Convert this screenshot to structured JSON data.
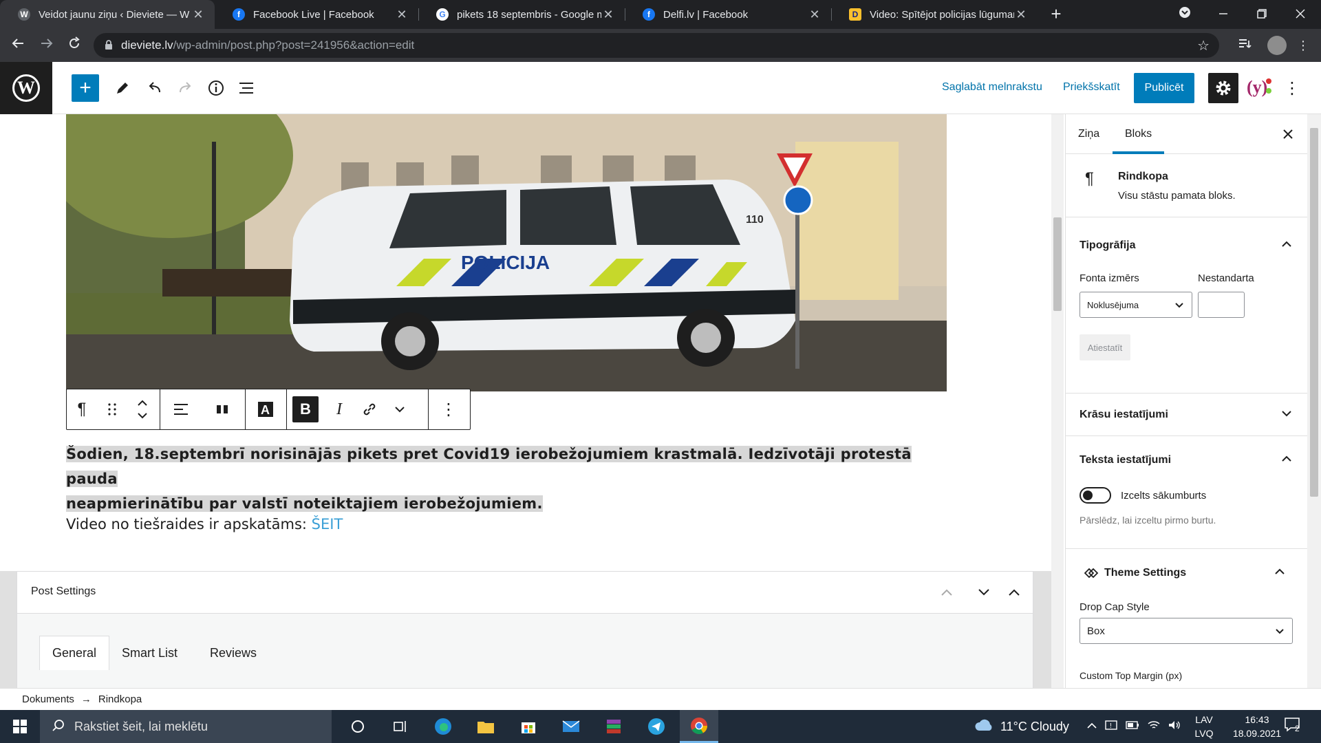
{
  "browser": {
    "tabs": [
      {
        "title": "Veidot jaunu ziņu ‹ Dieviete — W",
        "icon": "wordpress-icon",
        "active": true
      },
      {
        "title": "Facebook Live | Facebook",
        "icon": "facebook-icon"
      },
      {
        "title": "pikets 18 septembris - Google m",
        "icon": "google-icon"
      },
      {
        "title": "Delfi.lv | Facebook",
        "icon": "facebook-icon"
      },
      {
        "title": "Video: Spītējot policijas lūguman",
        "icon": "delfi-icon"
      }
    ],
    "close_glyph": "✕",
    "new_tab_glyph": "+",
    "url_host": "dieviete.lv",
    "url_path": "/wp-admin/post.php?post=241956&action=edit"
  },
  "editor_header": {
    "save_draft": "Saglabāt melnrakstu",
    "preview": "Priekšskatīt",
    "publish": "Publicēt"
  },
  "content": {
    "bold_paragraph_line1": "Šodien, 18.septembrī norisinājās pikets pret Covid19 ierobežojumiem krastmalā. Iedzīvotāji protestā pauda",
    "bold_paragraph_line2": "neapmierinātību par valstī noteiktajiem ierobežojumiem.",
    "paragraph2_text": "Video no tiešraides ir apskatāms: ",
    "paragraph2_link": "ŠEIT",
    "image_signage": "POLICIJA",
    "image_car_number": "110"
  },
  "metabox": {
    "title": "Post Settings",
    "tabs": [
      "General",
      "Smart List",
      "Reviews"
    ]
  },
  "sidebar": {
    "tabs": [
      "Ziņa",
      "Bloks"
    ],
    "block_title": "Rindkopa",
    "block_desc": "Visu stāstu pamata bloks.",
    "typography": {
      "title": "Tipogrāfija",
      "font_size_label": "Fonta izmērs",
      "custom_label": "Nestandarta",
      "select_value": "Noklusējuma",
      "reset": "Atiestatīt"
    },
    "colors_title": "Krāsu iestatījumi",
    "text_settings": {
      "title": "Teksta iestatījumi",
      "toggle_label": "Izcelts sākumburts",
      "help": "Pārslēdz, lai izceltu pirmo burtu."
    },
    "theme_settings": {
      "title": "Theme Settings",
      "drop_cap_label": "Drop Cap Style",
      "drop_cap_value": "Box",
      "cut_label": "Custom Top Margin (px)"
    }
  },
  "breadcrumb": {
    "root": "Dokuments",
    "arrow": "→",
    "current": "Rindkopa"
  },
  "taskbar": {
    "search_placeholder": "Rakstiet šeit, lai meklētu",
    "weather": "11°C  Cloudy",
    "lang_top": "LAV",
    "lang_bottom": "LVQ",
    "time": "16:43",
    "date": "18.09.2021",
    "notifications": "2"
  },
  "colors": {
    "wp_blue": "#007cba",
    "link_blue": "#3a9fd6",
    "dark": "#1e1e1e"
  }
}
